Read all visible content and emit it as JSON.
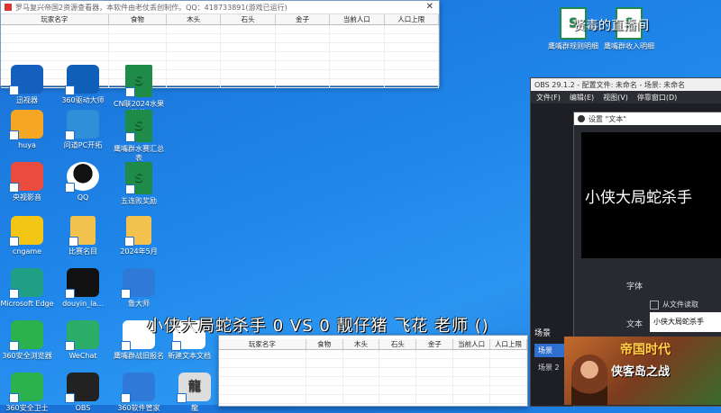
{
  "top_window": {
    "title": "罗马复兴帝国2资源查看器，本软件由老仗丢创制作。QQ：418733891(游戏已运行)",
    "columns": [
      "玩家名字",
      "食物",
      "木头",
      "石头",
      "金子",
      "当前人口",
      "人口上限"
    ]
  },
  "bottom_window": {
    "columns": [
      "玩家名字",
      "食物",
      "木头",
      "石头",
      "金子",
      "当前人口",
      "人口上限"
    ]
  },
  "desktop_icons": [
    {
      "label": "迅视器",
      "color": "#1560bd"
    },
    {
      "label": "360驱动大师",
      "color": "#0f5fb8"
    },
    {
      "label": "CN联2024水果清单",
      "color": "#1e8b48"
    },
    {
      "label": "huya",
      "color": "#f5a623"
    },
    {
      "label": "问道PC开拓",
      "color": "#2f8fd8"
    },
    {
      "label": "鹰嘴群水赛汇总表",
      "color": "#1e8b48"
    },
    {
      "label": "央视影音",
      "color": "#e94c3d"
    },
    {
      "label": "QQ",
      "color": "#ffffff"
    },
    {
      "label": "五连败奖励",
      "color": "#1e8b48"
    },
    {
      "label": "cngame",
      "color": "#f3c515"
    },
    {
      "label": "比赛名目",
      "color": "#f2c14e"
    },
    {
      "label": "2024年5月",
      "color": "#f2c14e"
    },
    {
      "label": "Microsoft Edge",
      "color": "#1fa085"
    },
    {
      "label": "douyin_la...",
      "color": "#111111"
    },
    {
      "label": "鲁大师",
      "color": "#2f7ad8"
    },
    {
      "label": "360安全浏览器",
      "color": "#2bb24c"
    },
    {
      "label": "WeChat",
      "color": "#2aae67"
    },
    {
      "label": "鹰嘴群战旧报名",
      "color": "#ffffff"
    },
    {
      "label": "新建文本文档",
      "color": "#ffffff"
    },
    {
      "label": "360安全卫士",
      "color": "#2bb24c"
    },
    {
      "label": "OBS",
      "color": "#222222"
    },
    {
      "label": "360软件管家",
      "color": "#2f7ad8"
    },
    {
      "label": "龍",
      "color": "#dddddd"
    }
  ],
  "top_right_icons": [
    {
      "label": "鹰嘴群规则明细"
    },
    {
      "label": "鹰嘴群收入明细"
    }
  ],
  "watermark": "贤毒的直播间",
  "obs": {
    "title": "OBS 29.1.2 - 配置文件: 未命名 - 场景: 未命名",
    "menus": [
      "文件(F)",
      "编辑(E)",
      "视图(V)",
      "停靠窗口(D)"
    ],
    "scene_label": "场景",
    "scenes": [
      "场景",
      "场景 2"
    ],
    "dialog_title": "设置 \"文本\"",
    "preview_text": "小侠大局蛇杀手",
    "font_label": "字体",
    "from_file_label": "从文件读取",
    "text_label": "文本",
    "text_value": "小侠大局蛇杀手"
  },
  "overlay_text": "小侠大局蛇杀手 0  VS 0 靓仔猪 飞花 老师 ()",
  "ad": {
    "title": "帝国时代",
    "subtitle": "侠客岛之战"
  }
}
